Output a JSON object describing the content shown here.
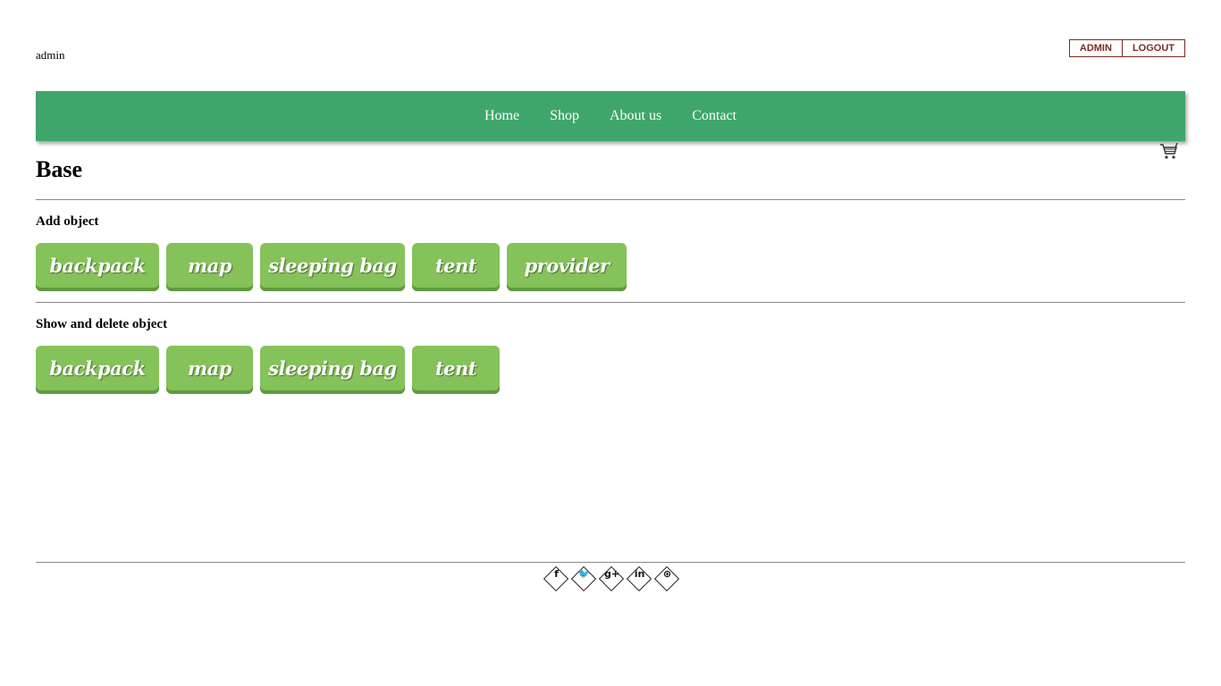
{
  "header": {
    "username": "admin",
    "buttons": {
      "admin": "ADMIN",
      "logout": "LOGOUT"
    }
  },
  "nav": {
    "items": [
      "Home",
      "Shop",
      "About us",
      "Contact"
    ]
  },
  "cart": {
    "icon": "cart-icon"
  },
  "main": {
    "title": "Base",
    "add_section": {
      "title": "Add object",
      "buttons": [
        "backpack",
        "map",
        "sleeping bag",
        "tent",
        "provider"
      ]
    },
    "show_section": {
      "title": "Show and delete object",
      "buttons": [
        "backpack",
        "map",
        "sleeping bag",
        "tent"
      ]
    }
  },
  "footer": {
    "social": [
      {
        "icon": "facebook-icon",
        "glyph": "f"
      },
      {
        "icon": "twitter-icon",
        "glyph": "🐦"
      },
      {
        "icon": "google-plus-icon",
        "glyph": "g+"
      },
      {
        "icon": "linkedin-icon",
        "glyph": "in"
      },
      {
        "icon": "dribbble-icon",
        "glyph": "⊛"
      }
    ]
  },
  "colors": {
    "nav_bg": "#3fa66b",
    "button_bg": "#85c25a",
    "button_shadow": "#5f9a3d",
    "top_button_border": "#7a2a22"
  }
}
